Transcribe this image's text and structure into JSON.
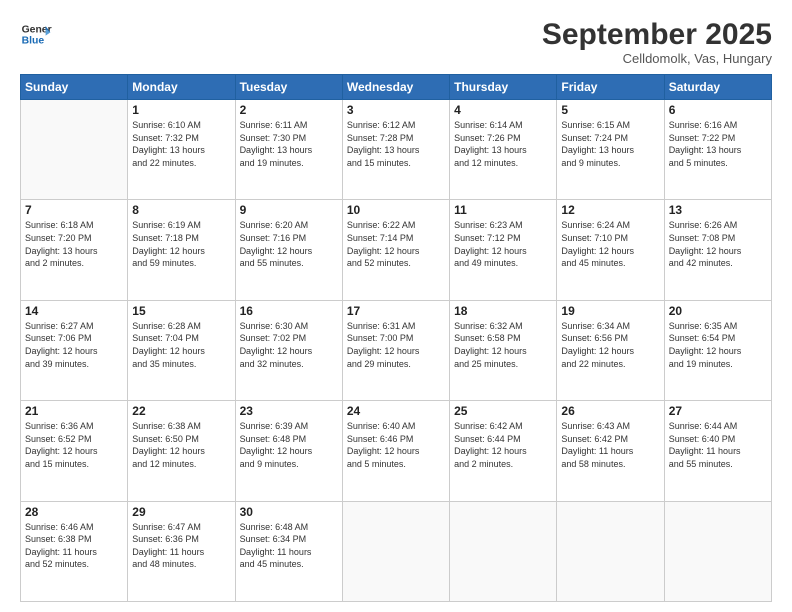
{
  "logo": {
    "line1": "General",
    "line2": "Blue"
  },
  "header": {
    "month": "September 2025",
    "location": "Celldomolk, Vas, Hungary"
  },
  "weekdays": [
    "Sunday",
    "Monday",
    "Tuesday",
    "Wednesday",
    "Thursday",
    "Friday",
    "Saturday"
  ],
  "weeks": [
    [
      {
        "day": "",
        "info": ""
      },
      {
        "day": "1",
        "info": "Sunrise: 6:10 AM\nSunset: 7:32 PM\nDaylight: 13 hours\nand 22 minutes."
      },
      {
        "day": "2",
        "info": "Sunrise: 6:11 AM\nSunset: 7:30 PM\nDaylight: 13 hours\nand 19 minutes."
      },
      {
        "day": "3",
        "info": "Sunrise: 6:12 AM\nSunset: 7:28 PM\nDaylight: 13 hours\nand 15 minutes."
      },
      {
        "day": "4",
        "info": "Sunrise: 6:14 AM\nSunset: 7:26 PM\nDaylight: 13 hours\nand 12 minutes."
      },
      {
        "day": "5",
        "info": "Sunrise: 6:15 AM\nSunset: 7:24 PM\nDaylight: 13 hours\nand 9 minutes."
      },
      {
        "day": "6",
        "info": "Sunrise: 6:16 AM\nSunset: 7:22 PM\nDaylight: 13 hours\nand 5 minutes."
      }
    ],
    [
      {
        "day": "7",
        "info": "Sunrise: 6:18 AM\nSunset: 7:20 PM\nDaylight: 13 hours\nand 2 minutes."
      },
      {
        "day": "8",
        "info": "Sunrise: 6:19 AM\nSunset: 7:18 PM\nDaylight: 12 hours\nand 59 minutes."
      },
      {
        "day": "9",
        "info": "Sunrise: 6:20 AM\nSunset: 7:16 PM\nDaylight: 12 hours\nand 55 minutes."
      },
      {
        "day": "10",
        "info": "Sunrise: 6:22 AM\nSunset: 7:14 PM\nDaylight: 12 hours\nand 52 minutes."
      },
      {
        "day": "11",
        "info": "Sunrise: 6:23 AM\nSunset: 7:12 PM\nDaylight: 12 hours\nand 49 minutes."
      },
      {
        "day": "12",
        "info": "Sunrise: 6:24 AM\nSunset: 7:10 PM\nDaylight: 12 hours\nand 45 minutes."
      },
      {
        "day": "13",
        "info": "Sunrise: 6:26 AM\nSunset: 7:08 PM\nDaylight: 12 hours\nand 42 minutes."
      }
    ],
    [
      {
        "day": "14",
        "info": "Sunrise: 6:27 AM\nSunset: 7:06 PM\nDaylight: 12 hours\nand 39 minutes."
      },
      {
        "day": "15",
        "info": "Sunrise: 6:28 AM\nSunset: 7:04 PM\nDaylight: 12 hours\nand 35 minutes."
      },
      {
        "day": "16",
        "info": "Sunrise: 6:30 AM\nSunset: 7:02 PM\nDaylight: 12 hours\nand 32 minutes."
      },
      {
        "day": "17",
        "info": "Sunrise: 6:31 AM\nSunset: 7:00 PM\nDaylight: 12 hours\nand 29 minutes."
      },
      {
        "day": "18",
        "info": "Sunrise: 6:32 AM\nSunset: 6:58 PM\nDaylight: 12 hours\nand 25 minutes."
      },
      {
        "day": "19",
        "info": "Sunrise: 6:34 AM\nSunset: 6:56 PM\nDaylight: 12 hours\nand 22 minutes."
      },
      {
        "day": "20",
        "info": "Sunrise: 6:35 AM\nSunset: 6:54 PM\nDaylight: 12 hours\nand 19 minutes."
      }
    ],
    [
      {
        "day": "21",
        "info": "Sunrise: 6:36 AM\nSunset: 6:52 PM\nDaylight: 12 hours\nand 15 minutes."
      },
      {
        "day": "22",
        "info": "Sunrise: 6:38 AM\nSunset: 6:50 PM\nDaylight: 12 hours\nand 12 minutes."
      },
      {
        "day": "23",
        "info": "Sunrise: 6:39 AM\nSunset: 6:48 PM\nDaylight: 12 hours\nand 9 minutes."
      },
      {
        "day": "24",
        "info": "Sunrise: 6:40 AM\nSunset: 6:46 PM\nDaylight: 12 hours\nand 5 minutes."
      },
      {
        "day": "25",
        "info": "Sunrise: 6:42 AM\nSunset: 6:44 PM\nDaylight: 12 hours\nand 2 minutes."
      },
      {
        "day": "26",
        "info": "Sunrise: 6:43 AM\nSunset: 6:42 PM\nDaylight: 11 hours\nand 58 minutes."
      },
      {
        "day": "27",
        "info": "Sunrise: 6:44 AM\nSunset: 6:40 PM\nDaylight: 11 hours\nand 55 minutes."
      }
    ],
    [
      {
        "day": "28",
        "info": "Sunrise: 6:46 AM\nSunset: 6:38 PM\nDaylight: 11 hours\nand 52 minutes."
      },
      {
        "day": "29",
        "info": "Sunrise: 6:47 AM\nSunset: 6:36 PM\nDaylight: 11 hours\nand 48 minutes."
      },
      {
        "day": "30",
        "info": "Sunrise: 6:48 AM\nSunset: 6:34 PM\nDaylight: 11 hours\nand 45 minutes."
      },
      {
        "day": "",
        "info": ""
      },
      {
        "day": "",
        "info": ""
      },
      {
        "day": "",
        "info": ""
      },
      {
        "day": "",
        "info": ""
      }
    ]
  ]
}
